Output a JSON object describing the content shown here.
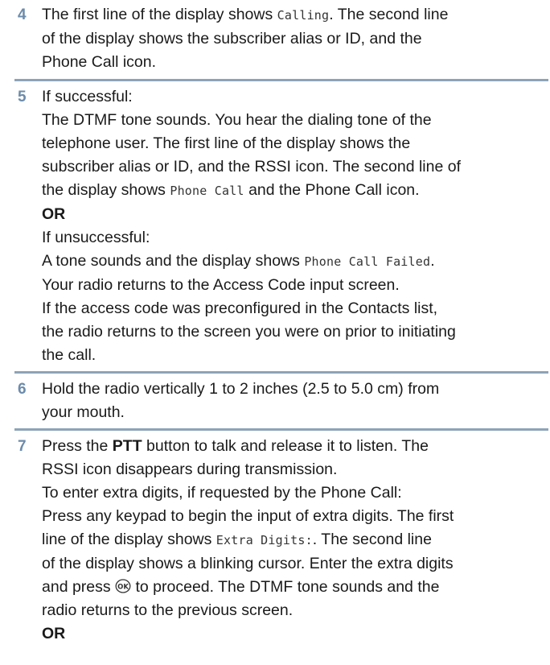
{
  "step4": {
    "number": "4",
    "l1a": "The first line of the display shows ",
    "l1code": "Calling",
    "l1b": ". The second line",
    "l2": "of the display shows the subscriber alias or ID, and the",
    "l3": "Phone Call icon."
  },
  "step5": {
    "number": "5",
    "l1": "If successful:",
    "l2": "The DTMF tone sounds. You hear the dialing tone of the",
    "l3": "telephone user. The first line of the display shows the",
    "l4": "subscriber alias or ID, and the RSSI icon. The second line of",
    "l5a": "the display shows ",
    "l5code": "Phone Call",
    "l5b": " and the Phone Call icon.",
    "or": "OR",
    "l6": "If unsuccessful:",
    "l7a": "A tone sounds and the display shows ",
    "l7code": "Phone Call Failed",
    "l7b": ".",
    "l8": "Your radio returns to the Access Code input screen.",
    "l9": "If the access code was preconfigured in the Contacts list,",
    "l10": "the radio returns to the screen you were on prior to initiating",
    "l11": "the call."
  },
  "step6": {
    "number": "6",
    "l1": "Hold the radio vertically 1 to 2 inches (2.5 to 5.0 cm) from",
    "l2": "your mouth."
  },
  "step7": {
    "number": "7",
    "l1a": "Press the ",
    "l1b": "PTT",
    "l1c": " button to talk and release it to listen. The",
    "l2": "RSSI icon disappears during transmission.",
    "l3": "To enter extra digits, if requested by the Phone Call:",
    "l4": "Press any keypad to begin the input of extra digits. The first",
    "l5a": "line of the display shows ",
    "l5code": "Extra Digits:",
    "l5b": ". The second line",
    "l6": "of the display shows a blinking cursor. Enter the extra digits",
    "l7a": "and press ",
    "l7b": " to proceed. The DTMF tone sounds and the",
    "l8": "radio returns to the previous screen.",
    "or": "OR",
    "ok_icon": "ok-button-icon",
    "ok_icon_text": "OK"
  }
}
